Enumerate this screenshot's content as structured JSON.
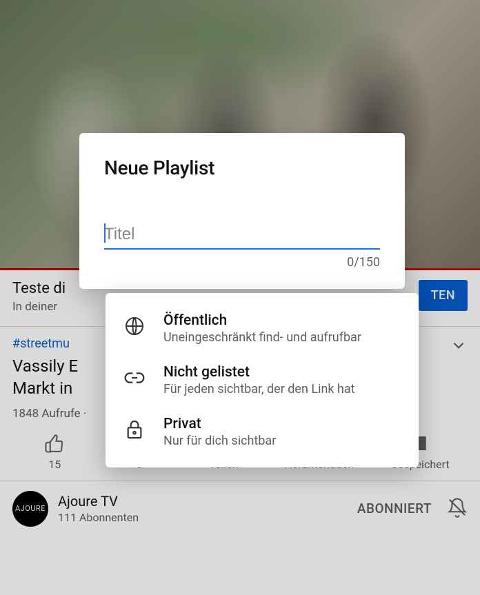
{
  "page": {
    "promo": {
      "title": "Teste di",
      "subtitle": "In deiner"
    },
    "cta_button": "TEN",
    "hashtag": "#streetmu",
    "video_title_line1": "Vassily E",
    "video_title_line2": "Markt in",
    "stats": "1848 Aufrufe ·",
    "actions": {
      "likes": "15",
      "dislikes": "0",
      "share": "Teilen",
      "download": "Herunterladen",
      "saved": "Gespeichert"
    },
    "channel": {
      "avatar_text": "AJOURE",
      "name": "Ajoure TV",
      "subs": "111 Abonnenten",
      "status": "ABONNIERT"
    }
  },
  "dialog": {
    "heading": "Neue Playlist",
    "placeholder": "Titel",
    "counter": "0/150"
  },
  "options": [
    {
      "title": "Öffentlich",
      "desc": "Uneingeschränkt find- und aufrufbar"
    },
    {
      "title": "Nicht gelistet",
      "desc": "Für jeden sichtbar, der den Link hat"
    },
    {
      "title": "Privat",
      "desc": "Nur für dich sichtbar"
    }
  ]
}
